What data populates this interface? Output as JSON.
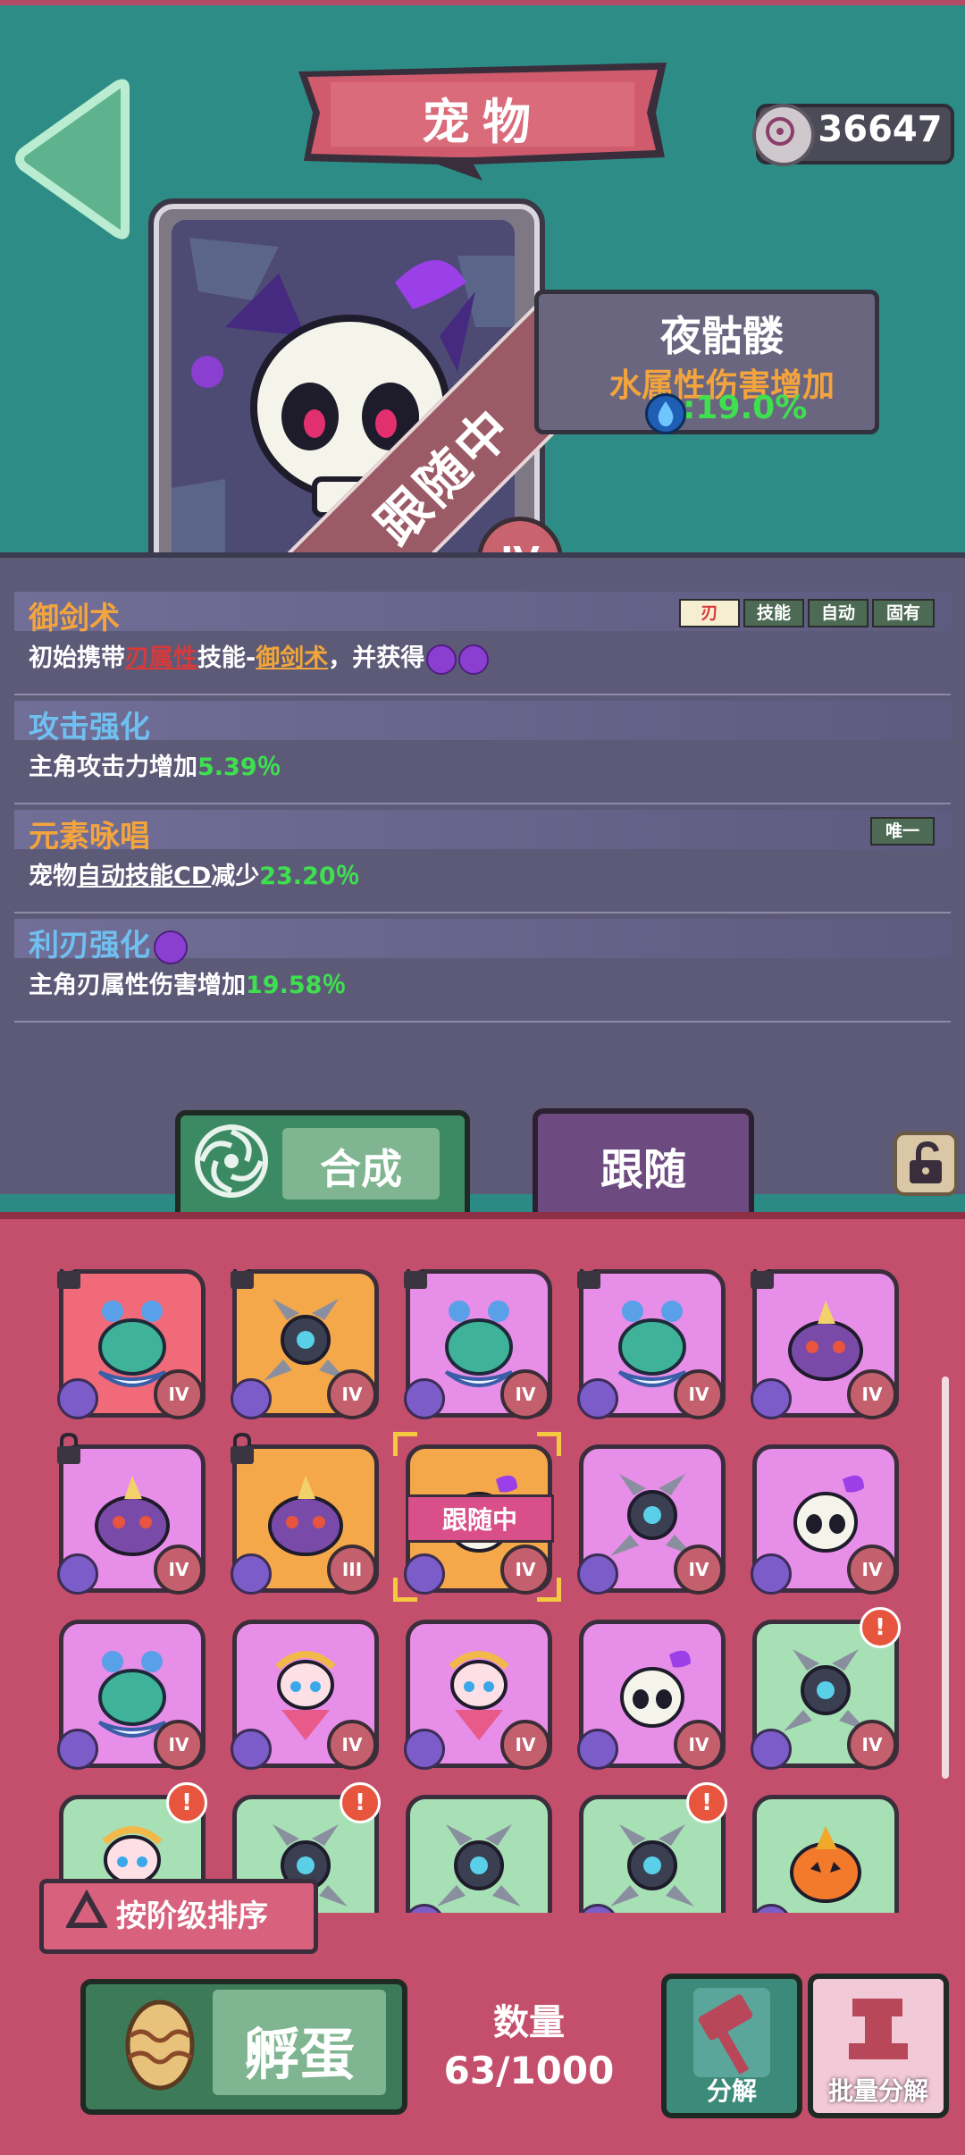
{
  "header": {
    "title": "宠物",
    "currency_value": "36647"
  },
  "featured_pet": {
    "name": "夜骷髅",
    "status_ribbon": "跟随中",
    "tier": "IV",
    "bonus_label": "水属性伤害增加",
    "bonus_value": ":19.0%"
  },
  "skills": [
    {
      "title": "御剑术",
      "title_color": "#f4a43c",
      "tags": [
        "刃",
        "技能",
        "自动",
        "固有"
      ],
      "desc_parts": [
        "初始携带",
        "刃属性",
        "技能-",
        "御剑术",
        "，并获得"
      ]
    },
    {
      "title": "攻击强化",
      "title_color": "#6fc0f0",
      "desc_text": "主角攻击力增加",
      "desc_value": "5.39％"
    },
    {
      "title": "元素咏唱",
      "title_color": "#f4a43c",
      "tag": "唯一",
      "desc_pre": "宠物",
      "desc_ul": "自动技能CD",
      "desc_text": "减少",
      "desc_value": "23.20％"
    },
    {
      "title": "利刃强化",
      "title_color": "#6fc0f0",
      "desc_text": "主角刃属性伤害增加",
      "desc_value": "19.58％"
    }
  ],
  "actions": {
    "merge_label": "合成",
    "follow_label": "跟随"
  },
  "inventory": {
    "follow_tag": "跟随中",
    "pets": [
      {
        "bg": "red",
        "tier": "IV",
        "locked": true,
        "kind": "ghost"
      },
      {
        "bg": "orange",
        "tier": "IV",
        "locked": true,
        "kind": "orb"
      },
      {
        "bg": "pink",
        "tier": "IV",
        "locked": true,
        "kind": "ghost"
      },
      {
        "bg": "pink",
        "tier": "IV",
        "locked": true,
        "kind": "ghost"
      },
      {
        "bg": "pink",
        "tier": "IV",
        "locked": true,
        "kind": "horn"
      },
      {
        "bg": "pink",
        "tier": "IV",
        "locked": true,
        "kind": "horn"
      },
      {
        "bg": "orange",
        "tier": "III",
        "locked": true,
        "kind": "horn"
      },
      {
        "bg": "orange",
        "tier": "IV",
        "locked": false,
        "kind": "skull",
        "following": true
      },
      {
        "bg": "pink",
        "tier": "IV",
        "locked": false,
        "kind": "orb"
      },
      {
        "bg": "pink",
        "tier": "IV",
        "locked": false,
        "kind": "skull"
      },
      {
        "bg": "pink",
        "tier": "IV",
        "locked": false,
        "kind": "ghost"
      },
      {
        "bg": "pink",
        "tier": "IV",
        "locked": false,
        "kind": "fairy"
      },
      {
        "bg": "pink",
        "tier": "IV",
        "locked": false,
        "kind": "fairy"
      },
      {
        "bg": "pink",
        "tier": "IV",
        "locked": false,
        "kind": "skull"
      },
      {
        "bg": "green",
        "tier": "IV",
        "locked": false,
        "kind": "orb",
        "alert": "!"
      },
      {
        "bg": "green",
        "tier": "",
        "locked": false,
        "kind": "fairy",
        "alert": "!"
      },
      {
        "bg": "green",
        "tier": "",
        "locked": false,
        "kind": "orb",
        "alert": "!"
      },
      {
        "bg": "green",
        "tier": "",
        "locked": false,
        "kind": "orb"
      },
      {
        "bg": "green",
        "tier": "",
        "locked": false,
        "kind": "orb",
        "alert": "!"
      },
      {
        "bg": "green",
        "tier": "",
        "locked": false,
        "kind": "pumpkin"
      }
    ]
  },
  "bottom": {
    "sort_label": "按阶级排序",
    "hatch_label": "孵蛋",
    "count_label": "数量",
    "count_value": "63/1000",
    "decompose_label": "分解",
    "batch_decompose_label": "批量分解"
  },
  "icons": [
    "back-arrow-icon",
    "coin-icon",
    "water-icon",
    "swirl-icon",
    "lock-icon",
    "alert-icon",
    "egg-icon",
    "hammer-icon",
    "anvil-icon",
    "sort-triangle-icon"
  ]
}
